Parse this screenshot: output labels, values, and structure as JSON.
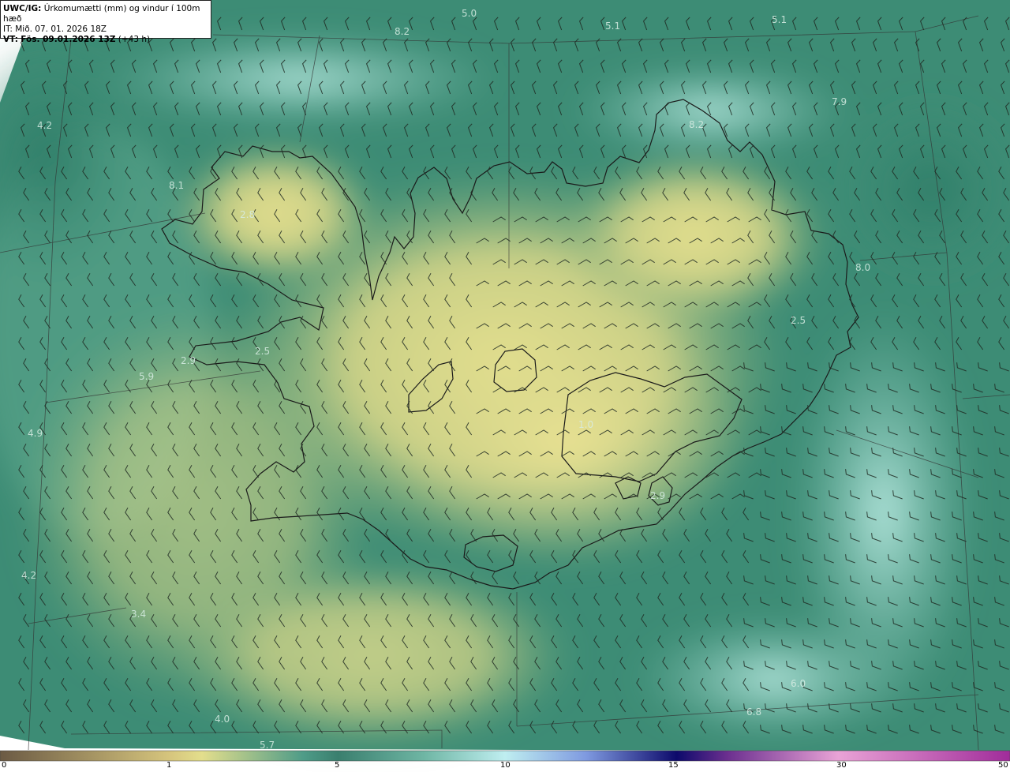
{
  "header": {
    "product": "UWC/IG:",
    "title": "Úrkomumætti (mm) og vindur í 100m hæð",
    "init_time": "IT: Mið. 07. 01. 2026 18Z",
    "valid_label": "VT:",
    "valid_time": "Fös. 09.01.2026 13Z",
    "lead": "(+43 h)"
  },
  "field_labels": [
    "5.0",
    "5.1",
    "5.1",
    "8.2",
    "4.2",
    "7.9",
    "8.2",
    "8.1",
    "2.8",
    "8.0",
    "2.5",
    "2.9",
    "2.5",
    "5.9",
    "4.9",
    "2.9",
    "1.0",
    "4.2",
    "3.4",
    "4.0",
    "5.7",
    "6.0",
    "6.8"
  ],
  "colorbar": {
    "tick_labels": [
      "0",
      "1",
      "5",
      "10",
      "15",
      "30",
      "50"
    ],
    "colors": [
      "#6b5a44",
      "#d4c882",
      "#e2dd8a",
      "#3a7f6e",
      "#4f9c88",
      "#bfeef0",
      "#4a5fc4",
      "#0d0a6b",
      "#e9a3d6",
      "#a02c9a"
    ]
  },
  "colors": {
    "sea_base": "#3d8c75",
    "land_low": "#6ea77a",
    "land_dry": "#d8d88a",
    "cloud_light": "#a8dcd4",
    "coastline": "#1a1a1a",
    "grid_line": "#333333",
    "barb": "#1f2a22"
  }
}
